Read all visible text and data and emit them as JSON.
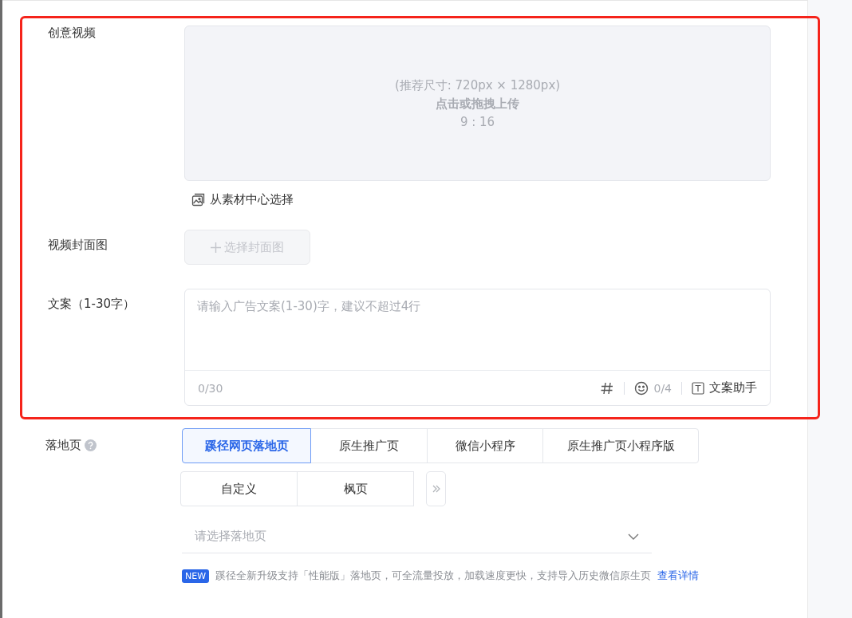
{
  "creative_video": {
    "label": "创意视频",
    "upload": {
      "hint": "(推荐尺寸: 720px × 1280px)",
      "action": "点击或拖拽上传",
      "ratio": "9 : 16"
    },
    "library_link": "从素材中心选择"
  },
  "cover": {
    "label": "视频封面图",
    "button": "选择封面图",
    "disabled": true
  },
  "copy": {
    "label": "文案（1-30字）",
    "placeholder": "请输入广告文案(1-30)字，建议不超过4行",
    "count": "0/30",
    "emoji_count": "0/4",
    "assistant": "文案助手"
  },
  "landing": {
    "label": "落地页",
    "tabs": [
      {
        "label": "蹊径网页落地页",
        "selected": true
      },
      {
        "label": "原生推广页",
        "selected": false
      },
      {
        "label": "微信小程序",
        "selected": false
      },
      {
        "label": "原生推广页小程序版",
        "selected": false
      }
    ],
    "tabs_row2": [
      {
        "label": "自定义",
        "selected": false
      },
      {
        "label": "枫页",
        "selected": false
      }
    ],
    "select": {
      "placeholder": "请选择落地页"
    },
    "notice": {
      "badge": "NEW",
      "text": "蹊径全新升级支持「性能版」落地页，可全流量投放，加载速度更快，支持导入历史微信原生页",
      "link": "查看详情"
    }
  }
}
